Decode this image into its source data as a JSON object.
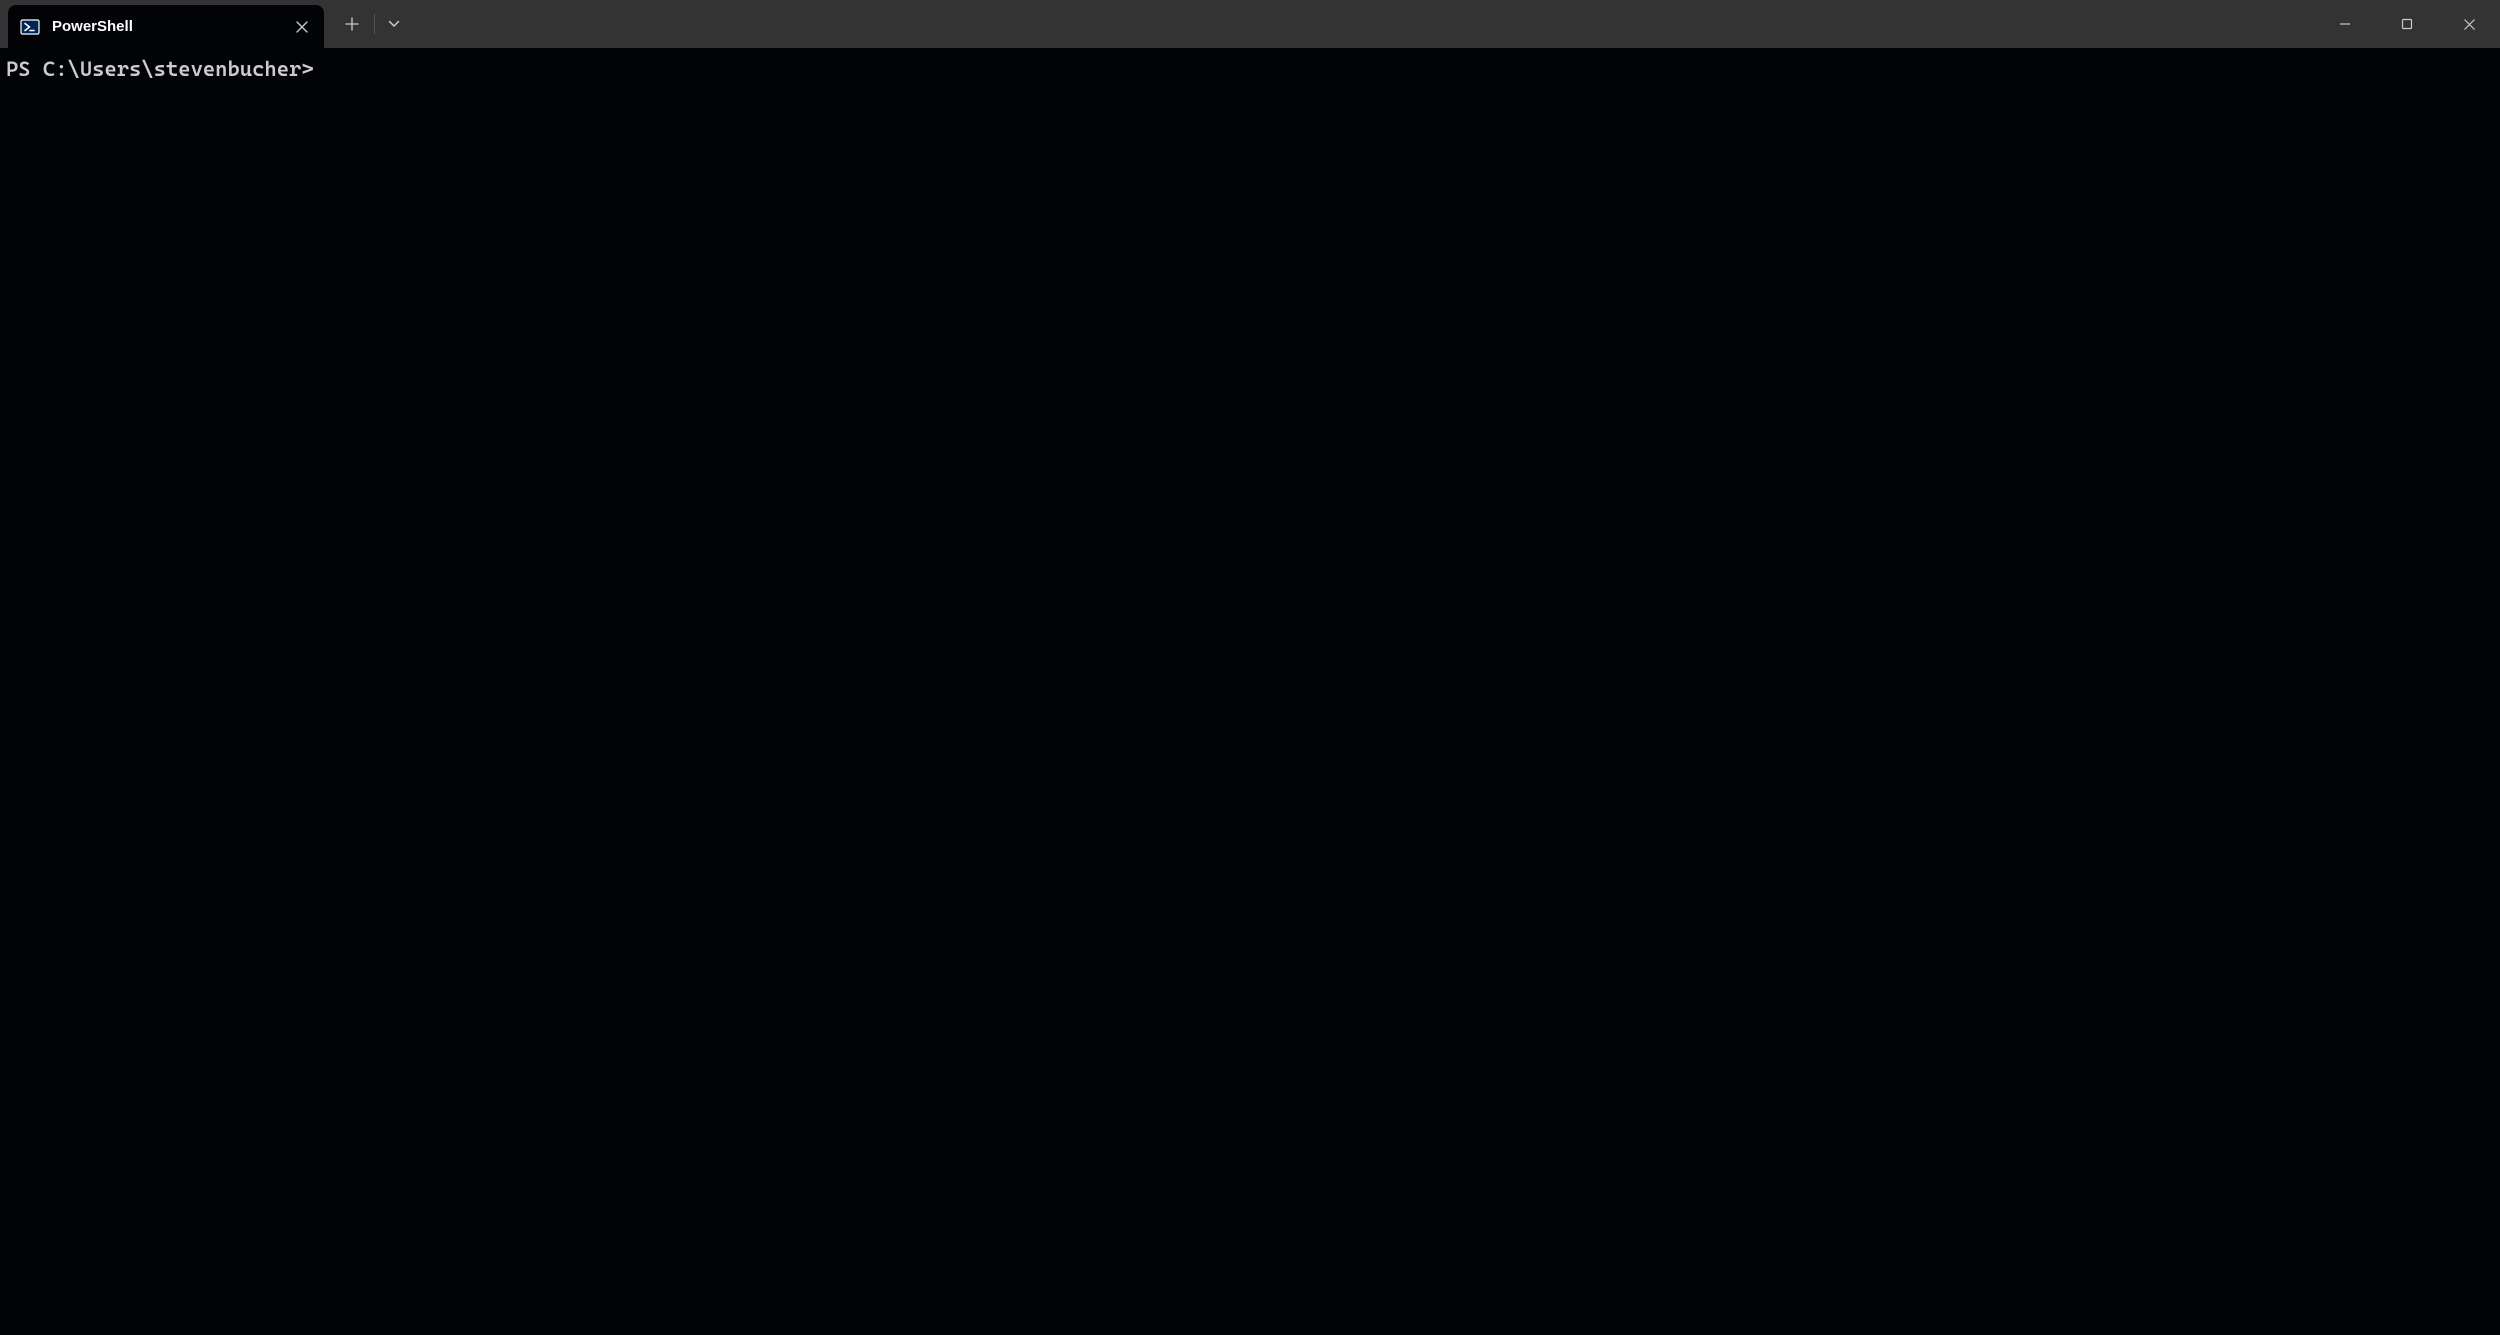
{
  "tabs": [
    {
      "label": "PowerShell",
      "icon": "powershell-icon"
    }
  ],
  "terminal": {
    "prompt": "PS C:\\Users\\stevenbucher>"
  }
}
